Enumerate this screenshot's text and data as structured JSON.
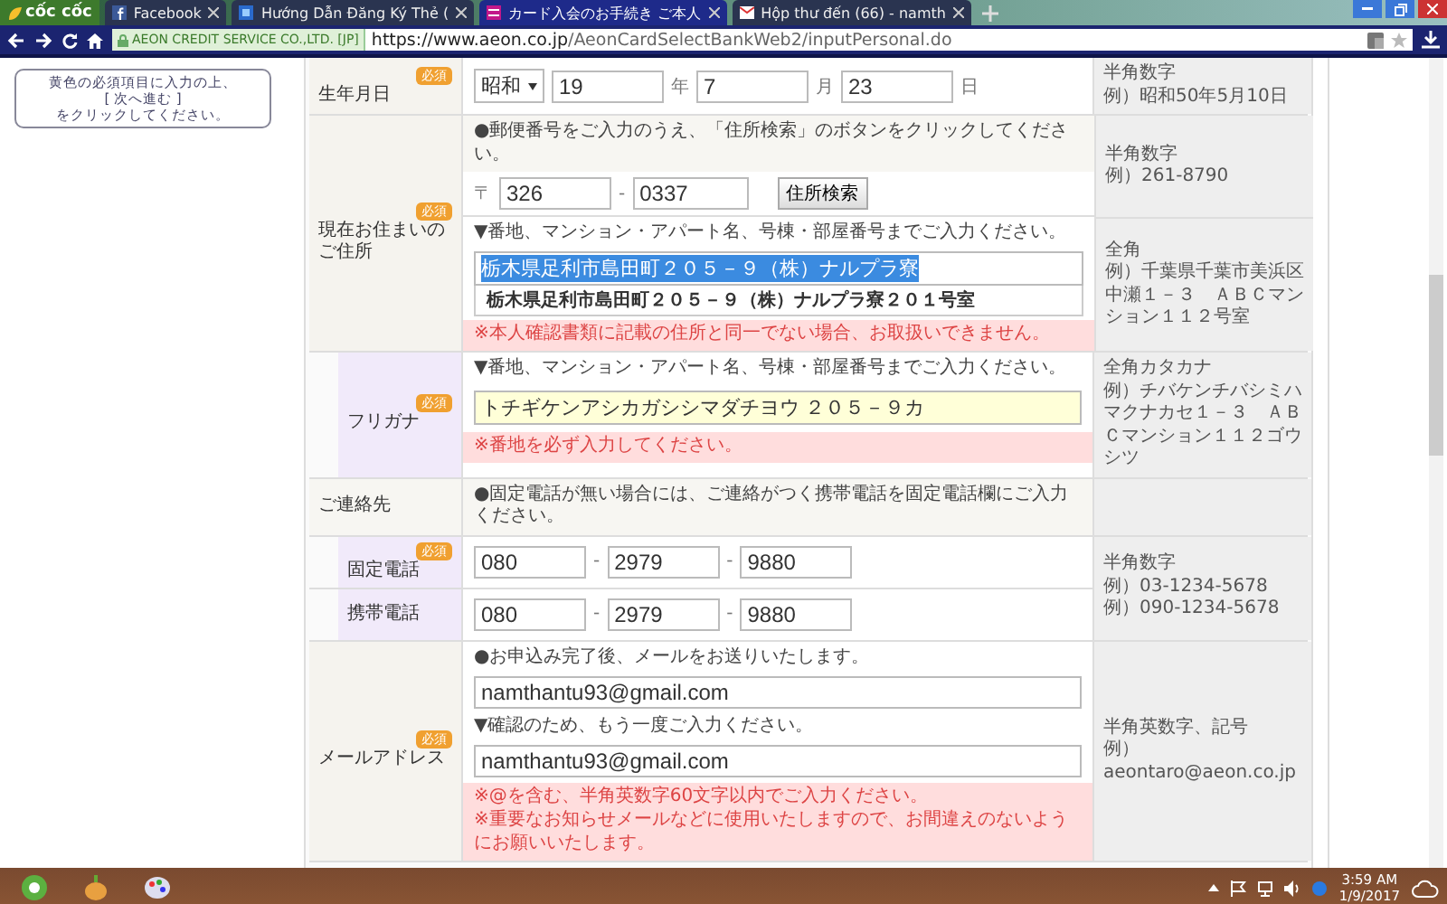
{
  "browser": {
    "logo": "cốc cốc",
    "tabs": [
      {
        "title": "Facebook",
        "selected": false
      },
      {
        "title": "Hướng Dẫn Đăng Ký Thẻ (",
        "selected": false
      },
      {
        "title": "カード入会のお手続き ご本人",
        "selected": true
      },
      {
        "title": "Hộp thư đến (66) - namth",
        "selected": false
      }
    ],
    "security_label": "AEON CREDIT SERVICE CO.,LTD. [JP]",
    "url_host": "https://www.aeon.co.jp",
    "url_path": "/AeonCardSelectBankWeb2/inputPersonal.do"
  },
  "sidebar_note": "黄色の必須項目に入力の上、\n[ 次へ進む ]\nをクリックしてください。",
  "rows": [
    {
      "kind": "date",
      "label": "生年月日",
      "badge": "必須",
      "era": "昭和",
      "year": "19",
      "year_unit": "年",
      "month": "7",
      "month_unit": "月",
      "day": "23",
      "day_unit": "日",
      "hint": [
        "半角数字",
        "例）昭和50年5月10日"
      ]
    },
    {
      "kind": "address",
      "label": "現在お住まいのご住所",
      "badge": "必須",
      "notice": "●郵便番号をご入力のうえ、「住所検索」のボタンをクリックしてください。",
      "postal_mark": "〒",
      "postal_1": "326",
      "separator": "-",
      "postal_2": "0337",
      "search_button": "住所検索",
      "postal_hint": [
        "半角数字",
        "例）261-8790"
      ],
      "instruction": "▼番地、マンション・アパート名、号棟・部屋番号までご入力ください。",
      "value": "栃木県足利市島田町２０５－９（株）ナルプラ寮",
      "text_selected": true,
      "suggestion": "栃木県足利市島田町２０５－９（株）ナルプラ寮２０１号室",
      "errors": [
        "※本人確認書類に記載の住所と同一でない場合、お取扱いできません。"
      ],
      "hint": [
        "全角",
        "例）千葉県千葉市美浜区中瀬１－３　ＡＢＣマンション１１２号室"
      ]
    },
    {
      "kind": "furigana",
      "label": "フリガナ",
      "badge": "必須",
      "instruction": "▼番地、マンション・アパート名、号棟・部屋番号までご入力ください。",
      "value": "トチギケンアシカガシシマダチヨウ ２０５－９カ",
      "errors": [
        "※番地を必ず入力してください。"
      ],
      "hint": [
        "全角カタカナ",
        "例）チバケンチバシミハマクナカセ１－３　ＡＢＣマンション１１２ゴウシツ"
      ]
    },
    {
      "kind": "section",
      "label": "ご連絡先",
      "notice": "●固定電話が無い場合には、ご連絡がつく携帯電話を固定電話欄にご入力ください。"
    },
    {
      "kind": "phones",
      "hint": [
        "半角数字",
        "例）03-1234-5678",
        "例）090-1234-5678"
      ],
      "items": [
        {
          "label": "固定電話",
          "badge": "必須",
          "parts": [
            "080",
            "2979",
            "9880"
          ],
          "separator": "-"
        },
        {
          "label": "携帯電話",
          "parts": [
            "080",
            "2979",
            "9880"
          ],
          "separator": "-"
        }
      ]
    },
    {
      "kind": "email",
      "label": "メールアドレス",
      "badge": "必須",
      "notice": "●お申込み完了後、メールをお送りいたします。",
      "value": "namthantu93@gmail.com",
      "confirm_instruction": "▼確認のため、もう一度ご入力ください。",
      "confirm_value": "namthantu93@gmail.com",
      "errors": [
        "※@を含む、半角英数字60文字以内でご入力ください。",
        "※重要なお知らせメールなどに使用いたしますので、お間違えのないようにお願いいたします。"
      ],
      "hint": [
        "半角英数字、記号",
        "例）",
        "aeontaro@aeon.co.jp"
      ]
    }
  ],
  "taskbar": {
    "time": "3:59 AM",
    "date": "1/9/2017"
  }
}
